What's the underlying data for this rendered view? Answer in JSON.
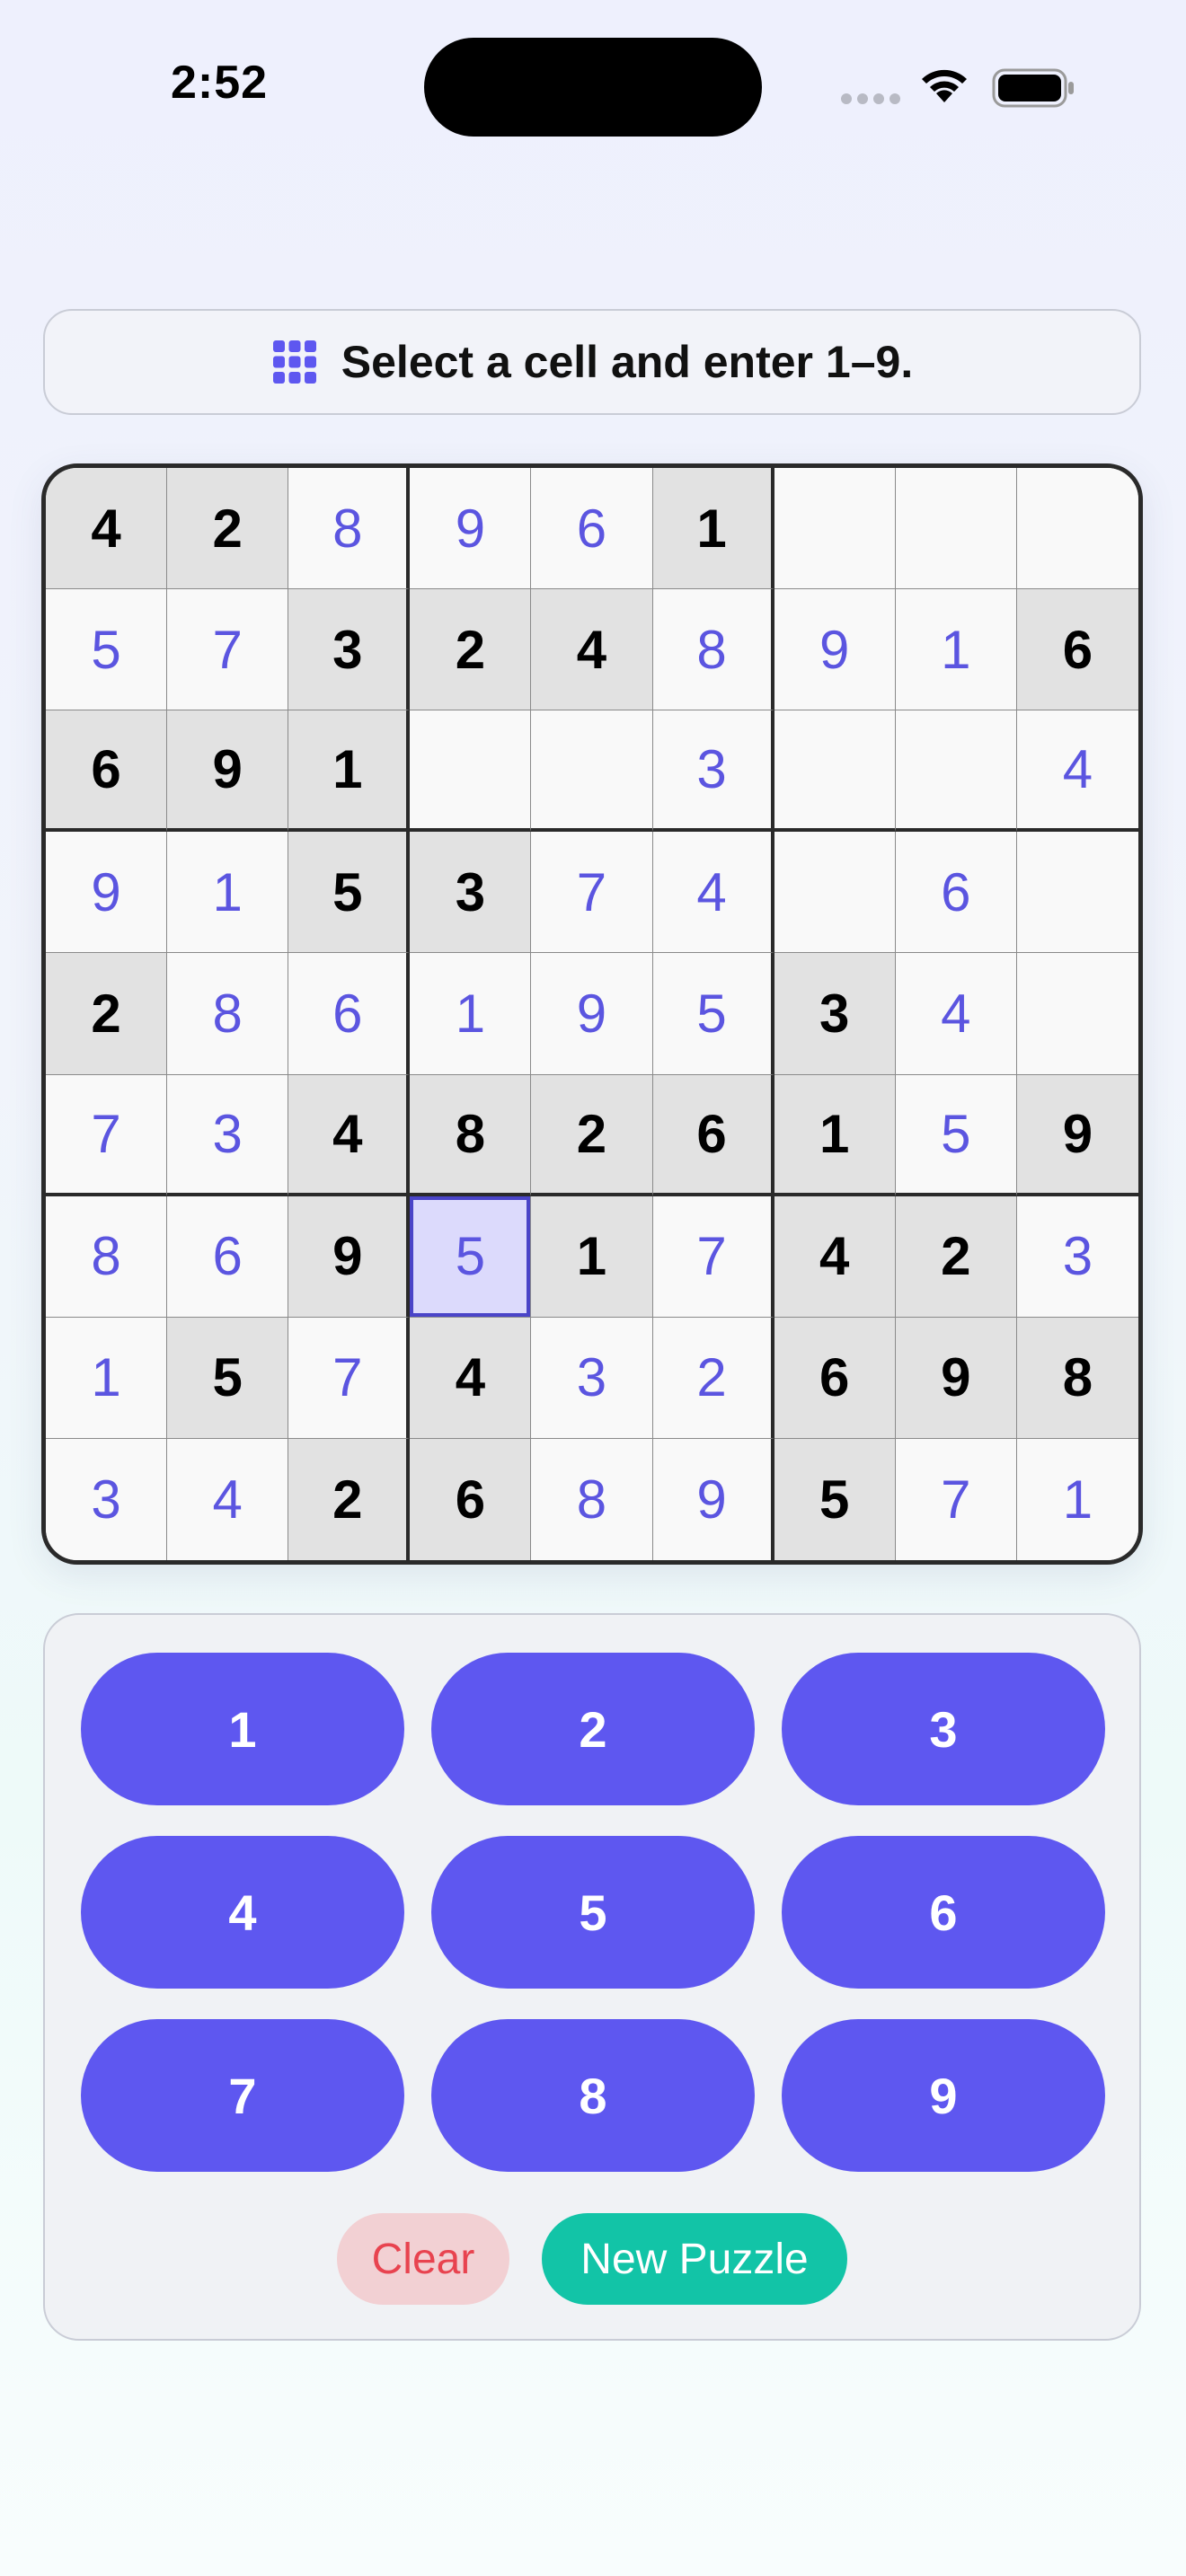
{
  "status_bar": {
    "time": "2:52",
    "icons": [
      "cellular-signal-icon",
      "wifi-icon",
      "battery-icon"
    ]
  },
  "message": {
    "icon": "grid-icon",
    "text": "Select a cell and enter 1–9."
  },
  "board": {
    "selected_cell": {
      "row": 7,
      "col": 4
    },
    "rows": [
      [
        {
          "v": "4",
          "k": "given"
        },
        {
          "v": "2",
          "k": "given"
        },
        {
          "v": "8",
          "k": "entry"
        },
        {
          "v": "9",
          "k": "entry"
        },
        {
          "v": "6",
          "k": "entry"
        },
        {
          "v": "1",
          "k": "given"
        },
        {
          "v": "",
          "k": "empty"
        },
        {
          "v": "",
          "k": "empty"
        },
        {
          "v": "",
          "k": "empty"
        }
      ],
      [
        {
          "v": "5",
          "k": "entry"
        },
        {
          "v": "7",
          "k": "entry"
        },
        {
          "v": "3",
          "k": "given"
        },
        {
          "v": "2",
          "k": "given"
        },
        {
          "v": "4",
          "k": "given"
        },
        {
          "v": "8",
          "k": "entry"
        },
        {
          "v": "9",
          "k": "entry"
        },
        {
          "v": "1",
          "k": "entry"
        },
        {
          "v": "6",
          "k": "given"
        }
      ],
      [
        {
          "v": "6",
          "k": "given"
        },
        {
          "v": "9",
          "k": "given"
        },
        {
          "v": "1",
          "k": "given"
        },
        {
          "v": "",
          "k": "empty"
        },
        {
          "v": "",
          "k": "empty"
        },
        {
          "v": "3",
          "k": "entry"
        },
        {
          "v": "",
          "k": "empty"
        },
        {
          "v": "",
          "k": "empty"
        },
        {
          "v": "4",
          "k": "entry"
        }
      ],
      [
        {
          "v": "9",
          "k": "entry"
        },
        {
          "v": "1",
          "k": "entry"
        },
        {
          "v": "5",
          "k": "given"
        },
        {
          "v": "3",
          "k": "given"
        },
        {
          "v": "7",
          "k": "entry"
        },
        {
          "v": "4",
          "k": "entry"
        },
        {
          "v": "",
          "k": "empty"
        },
        {
          "v": "6",
          "k": "entry"
        },
        {
          "v": "",
          "k": "empty"
        }
      ],
      [
        {
          "v": "2",
          "k": "given"
        },
        {
          "v": "8",
          "k": "entry"
        },
        {
          "v": "6",
          "k": "entry"
        },
        {
          "v": "1",
          "k": "entry"
        },
        {
          "v": "9",
          "k": "entry"
        },
        {
          "v": "5",
          "k": "entry"
        },
        {
          "v": "3",
          "k": "given"
        },
        {
          "v": "4",
          "k": "entry"
        },
        {
          "v": "",
          "k": "empty"
        }
      ],
      [
        {
          "v": "7",
          "k": "entry"
        },
        {
          "v": "3",
          "k": "entry"
        },
        {
          "v": "4",
          "k": "given"
        },
        {
          "v": "8",
          "k": "given"
        },
        {
          "v": "2",
          "k": "given"
        },
        {
          "v": "6",
          "k": "given"
        },
        {
          "v": "1",
          "k": "given"
        },
        {
          "v": "5",
          "k": "entry"
        },
        {
          "v": "9",
          "k": "given"
        }
      ],
      [
        {
          "v": "8",
          "k": "entry"
        },
        {
          "v": "6",
          "k": "entry"
        },
        {
          "v": "9",
          "k": "given"
        },
        {
          "v": "5",
          "k": "entry"
        },
        {
          "v": "1",
          "k": "given"
        },
        {
          "v": "7",
          "k": "entry"
        },
        {
          "v": "4",
          "k": "given"
        },
        {
          "v": "2",
          "k": "given"
        },
        {
          "v": "3",
          "k": "entry"
        }
      ],
      [
        {
          "v": "1",
          "k": "entry"
        },
        {
          "v": "5",
          "k": "given"
        },
        {
          "v": "7",
          "k": "entry"
        },
        {
          "v": "4",
          "k": "given"
        },
        {
          "v": "3",
          "k": "entry"
        },
        {
          "v": "2",
          "k": "entry"
        },
        {
          "v": "6",
          "k": "given"
        },
        {
          "v": "9",
          "k": "given"
        },
        {
          "v": "8",
          "k": "given"
        }
      ],
      [
        {
          "v": "3",
          "k": "entry"
        },
        {
          "v": "4",
          "k": "entry"
        },
        {
          "v": "2",
          "k": "given"
        },
        {
          "v": "6",
          "k": "given"
        },
        {
          "v": "8",
          "k": "entry"
        },
        {
          "v": "9",
          "k": "entry"
        },
        {
          "v": "5",
          "k": "given"
        },
        {
          "v": "7",
          "k": "entry"
        },
        {
          "v": "1",
          "k": "entry"
        }
      ]
    ]
  },
  "keypad": {
    "keys": [
      "1",
      "2",
      "3",
      "4",
      "5",
      "6",
      "7",
      "8",
      "9"
    ],
    "clear_label": "Clear",
    "new_puzzle_label": "New Puzzle"
  },
  "colors": {
    "accent": "#5e57f0",
    "entry_digit": "#5b55e0",
    "selected_cell_fill": "#dcdafc",
    "clear_text": "#e8434f",
    "clear_fill": "#f2d0d3",
    "new_puzzle_fill": "#12c4a7"
  }
}
